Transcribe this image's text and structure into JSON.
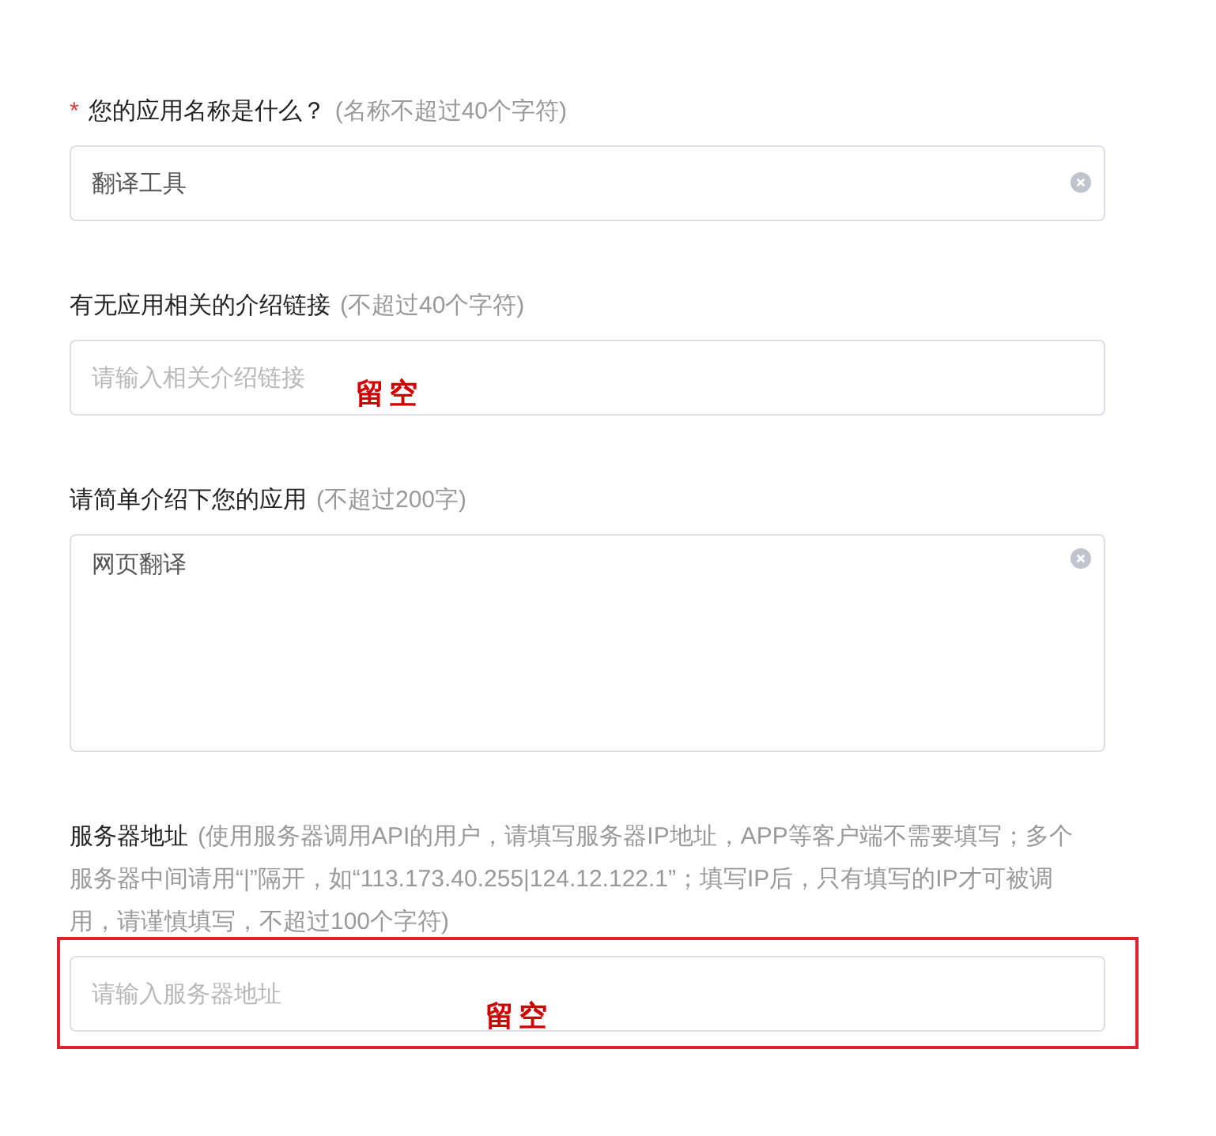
{
  "fields": [
    {
      "kind": "input",
      "required_mark": "*",
      "label": "您的应用名称是什么？",
      "hint": "(名称不超过40个字符)",
      "value": "翻译工具",
      "clearable": true
    },
    {
      "kind": "input",
      "label": "有无应用相关的介绍链接",
      "hint": "(不超过40个字符)",
      "placeholder": "请输入相关介绍链接",
      "annotation": "留空"
    },
    {
      "kind": "textarea",
      "label": "请简单介绍下您的应用",
      "hint": "(不超过200字)",
      "value": "网页翻译",
      "clearable": true
    },
    {
      "kind": "input",
      "label": "服务器地址",
      "hint": "(使用服务器调用API的用户，请填写服务器IP地址，APP等客户端不需要填写；多个服务器中间请用“|”隔开，如“113.173.40.255|124.12.122.1”；填写IP后，只有填写的IP才可被调用，请谨慎填写，不超过100个字符)",
      "placeholder": "请输入服务器地址",
      "annotation": "留空",
      "highlighted": true
    }
  ]
}
